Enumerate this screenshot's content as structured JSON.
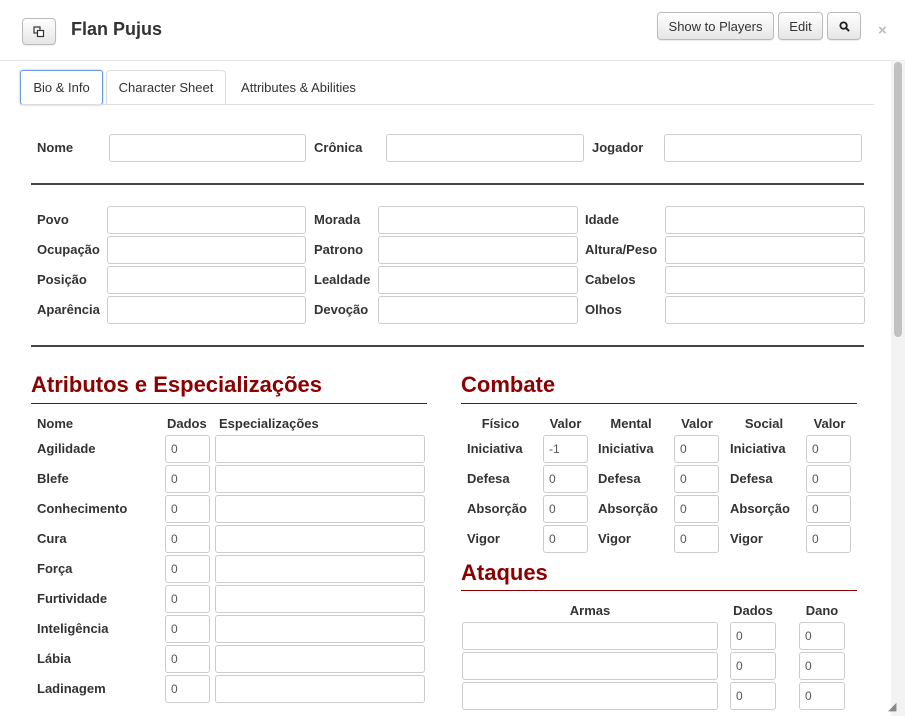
{
  "header": {
    "title": "Flan Pujus",
    "show_to_players_label": "Show to Players",
    "edit_label": "Edit",
    "search_icon": "search-icon",
    "popout_icon": "popout-icon",
    "close_label": "×"
  },
  "tabs": [
    {
      "label": "Bio & Info"
    },
    {
      "label": "Character Sheet"
    },
    {
      "label": "Attributes & Abilities"
    }
  ],
  "top_fields": {
    "nome_label": "Nome",
    "cronica_label": "Crônica",
    "jogador_label": "Jogador"
  },
  "details": {
    "col1": [
      "Povo",
      "Ocupação",
      "Posição",
      "Aparência"
    ],
    "col2": [
      "Morada",
      "Patrono",
      "Lealdade",
      "Devoção"
    ],
    "col3": [
      "Idade",
      "Altura/Peso",
      "Cabelos",
      "Olhos"
    ]
  },
  "atributos": {
    "title": "Atributos e Especializações",
    "headers": {
      "nome": "Nome",
      "dados": "Dados",
      "especializacoes": "Especializações"
    },
    "rows": [
      {
        "name": "Agilidade",
        "dados": "0"
      },
      {
        "name": "Blefe",
        "dados": "0"
      },
      {
        "name": "Conhecimento",
        "dados": "0"
      },
      {
        "name": "Cura",
        "dados": "0"
      },
      {
        "name": "Força",
        "dados": "0"
      },
      {
        "name": "Furtividade",
        "dados": "0"
      },
      {
        "name": "Inteligência",
        "dados": "0"
      },
      {
        "name": "Lábia",
        "dados": "0"
      },
      {
        "name": "Ladinagem",
        "dados": "0"
      }
    ]
  },
  "combate": {
    "title": "Combate",
    "headers": [
      "Físico",
      "Valor",
      "Mental",
      "Valor",
      "Social",
      "Valor"
    ],
    "rows": [
      {
        "label": "Iniciativa",
        "fisico": "-1",
        "mental": "0",
        "social": "0"
      },
      {
        "label": "Defesa",
        "fisico": "0",
        "mental": "0",
        "social": "0"
      },
      {
        "label": "Absorção",
        "fisico": "0",
        "mental": "0",
        "social": "0"
      },
      {
        "label": "Vigor",
        "fisico": "0",
        "mental": "0",
        "social": "0"
      }
    ]
  },
  "ataques": {
    "title": "Ataques",
    "headers": {
      "armas": "Armas",
      "dados": "Dados",
      "dano": "Dano"
    },
    "rows": [
      {
        "dados": "0",
        "dano": "0"
      },
      {
        "dados": "0",
        "dano": "0"
      },
      {
        "dados": "0",
        "dano": "0"
      }
    ]
  },
  "colors": {
    "accent_red": "#8b0000",
    "tab_active_border": "#6d9be0"
  }
}
